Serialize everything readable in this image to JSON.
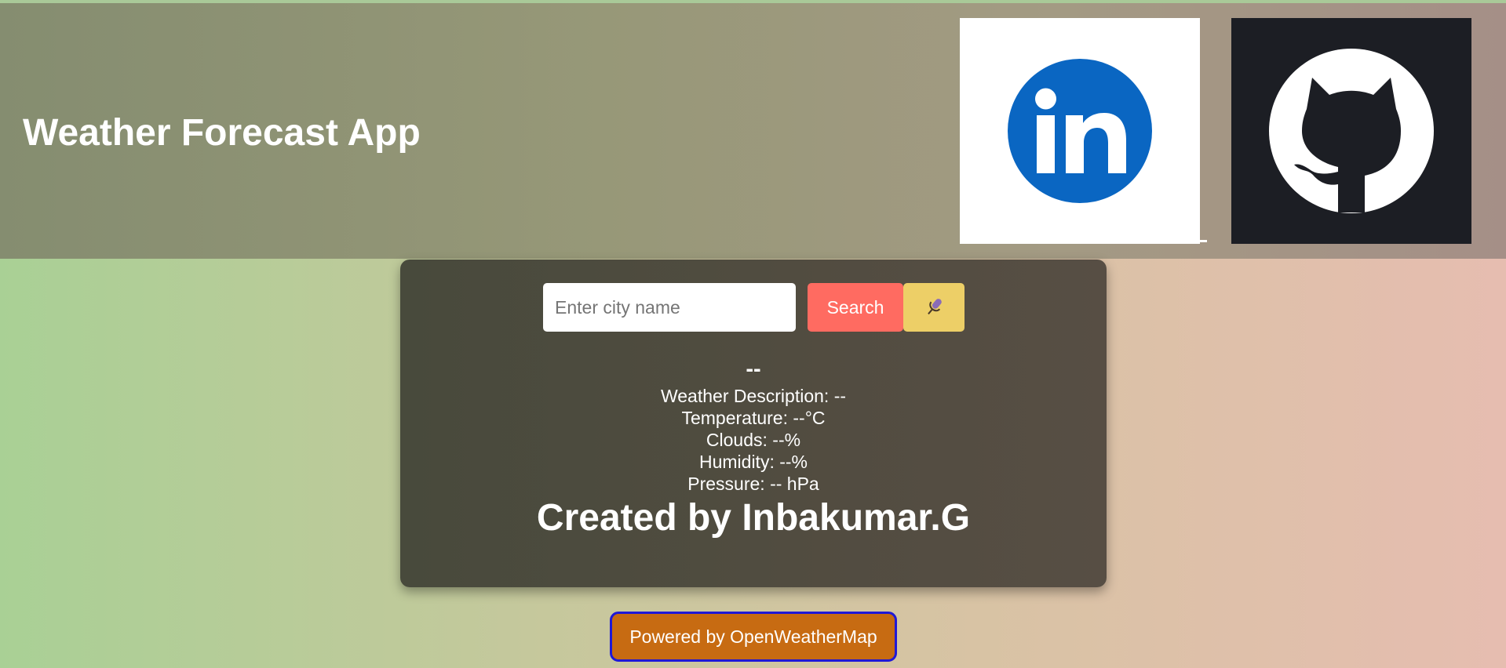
{
  "header": {
    "title": "Weather Forecast App",
    "social_links": [
      {
        "name": "LinkedIn",
        "icon": "linkedin-icon",
        "color": "#0a66c2"
      },
      {
        "name": "GitHub",
        "icon": "github-icon",
        "color": "#1c1e24"
      }
    ]
  },
  "search": {
    "placeholder": "Enter city name",
    "value": "",
    "button_label": "Search",
    "voice_icon": "microphone-icon"
  },
  "weather": {
    "city": "--",
    "description": "Weather Description: --",
    "temperature": "Temperature: --°C",
    "clouds": "Clouds: --%",
    "humidity": "Humidity: --%",
    "pressure": "Pressure: -- hPa"
  },
  "credit": "Created by Inbakumar.G",
  "footer": {
    "powered_label": "Powered by OpenWeatherMap"
  },
  "colors": {
    "search_button": "#ff6b61",
    "mic_button": "#edcf67",
    "powered_button": "#c76b12",
    "powered_border": "#1f18d6"
  }
}
